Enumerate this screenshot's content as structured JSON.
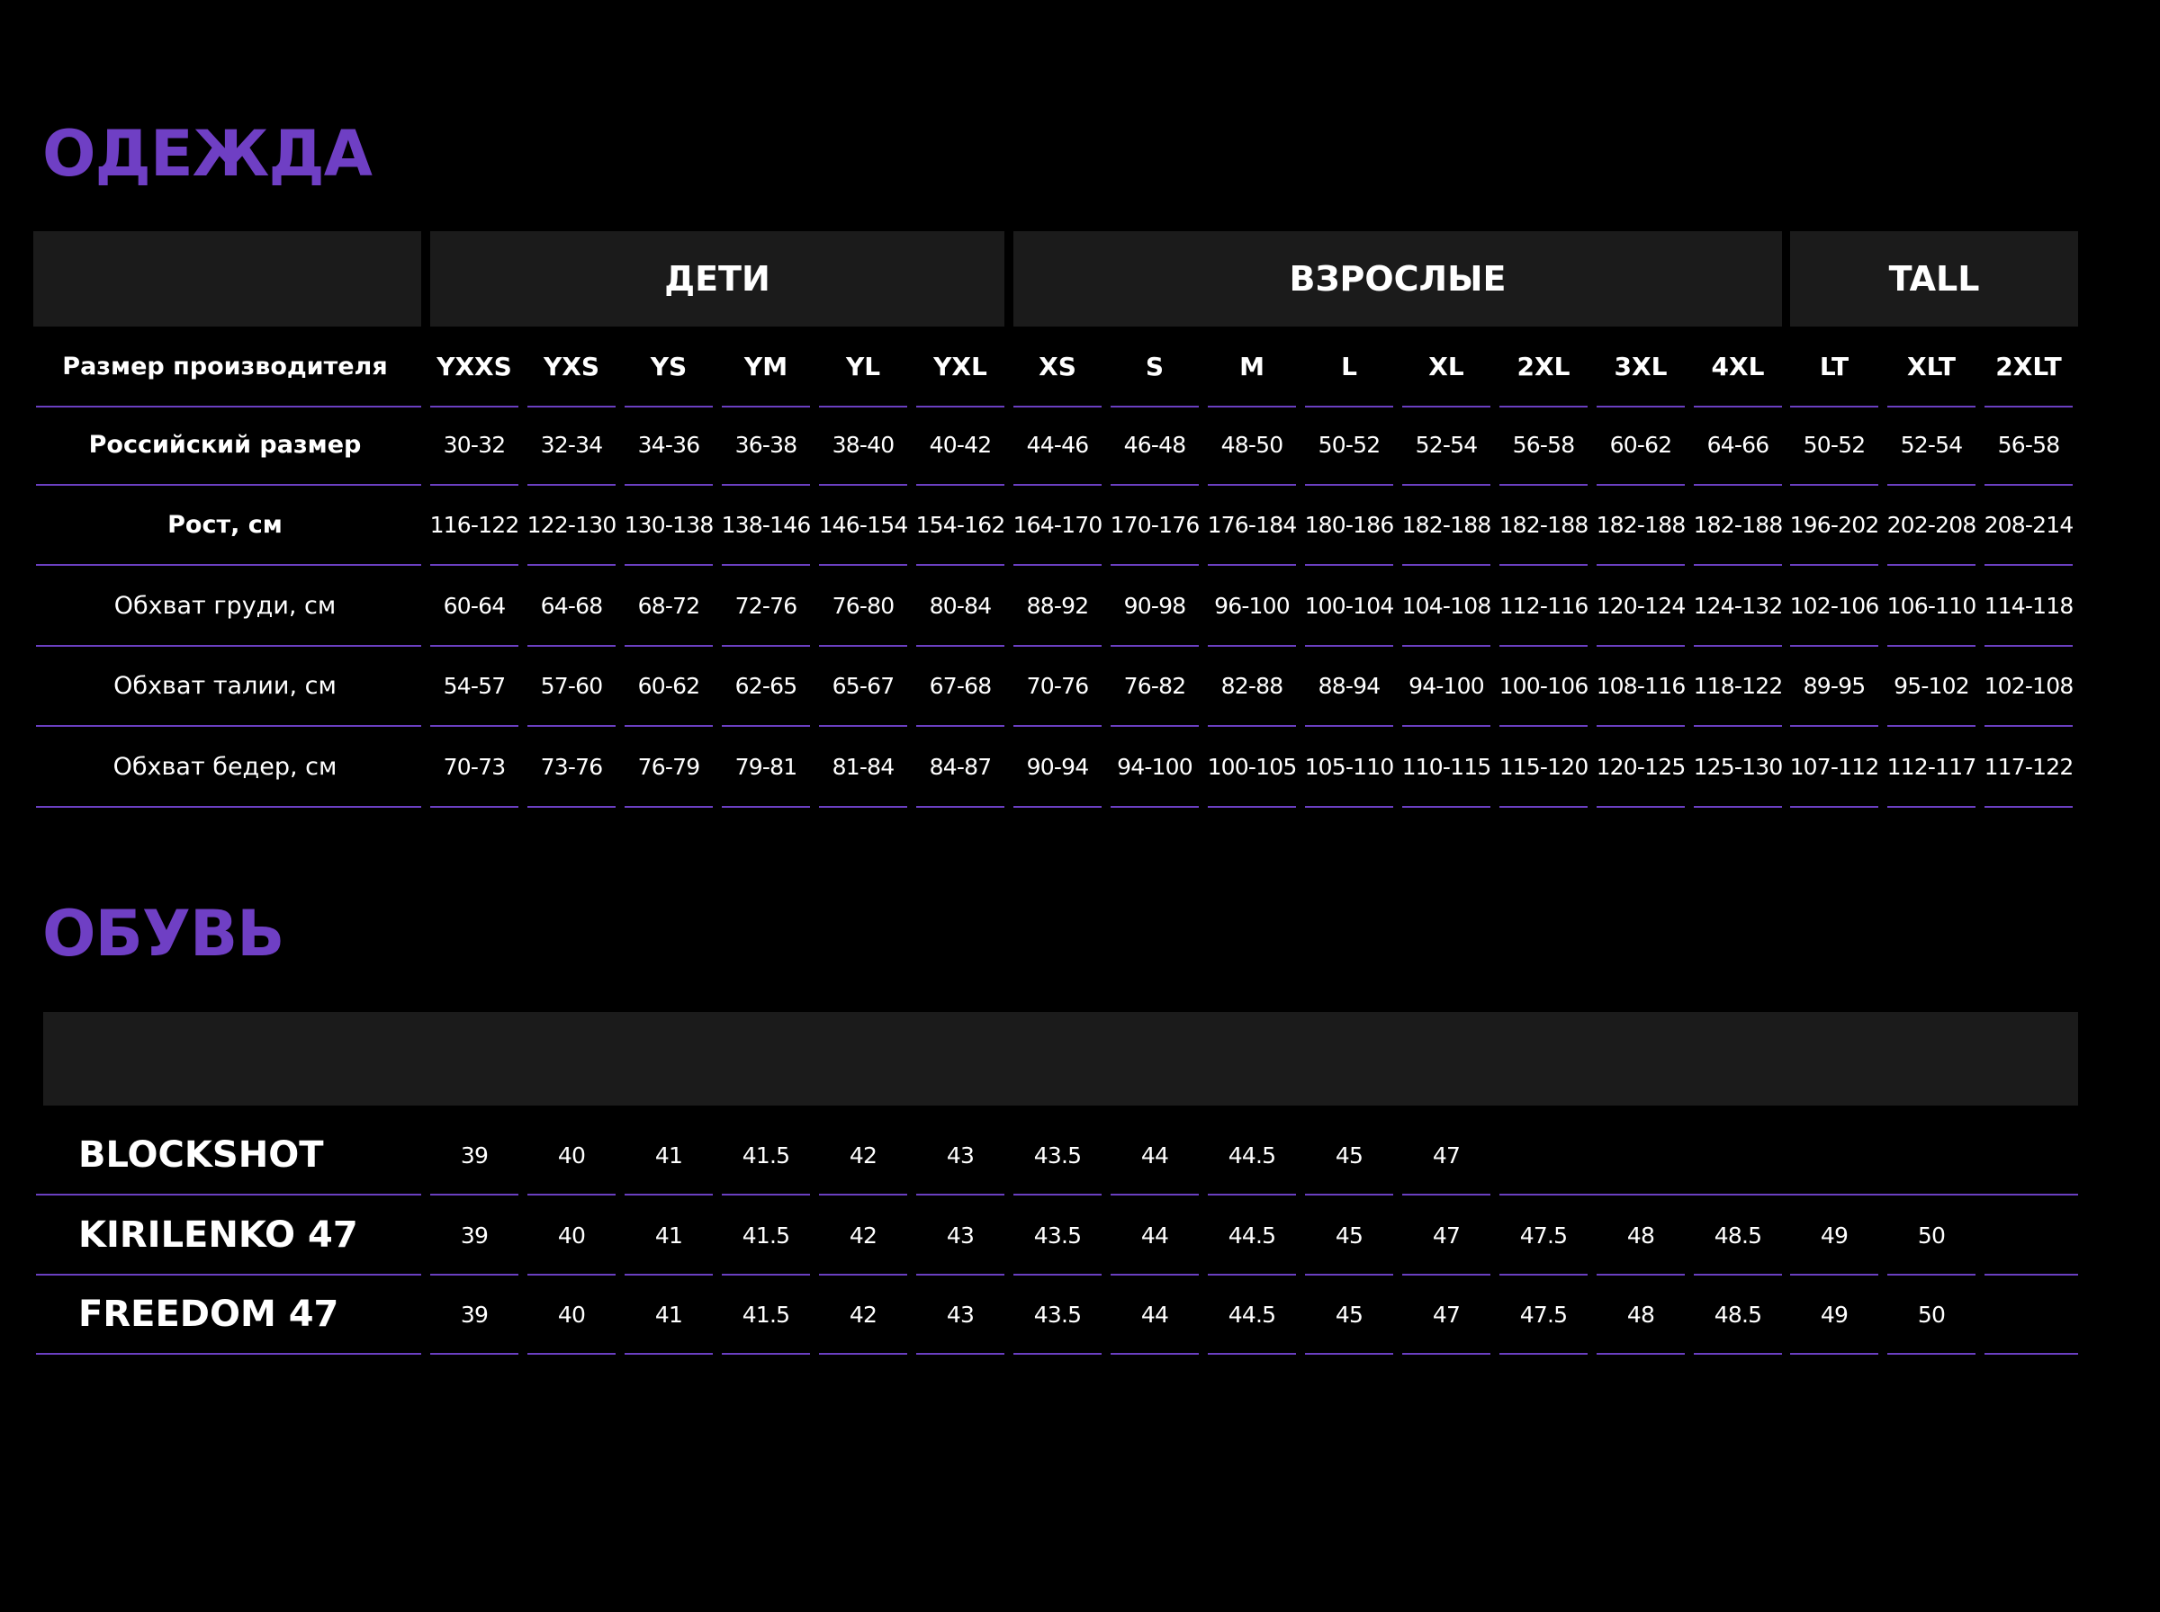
{
  "clothing": {
    "title": "ОДЕЖДА",
    "groups": [
      {
        "label": "ДЕТИ"
      },
      {
        "label": "ВЗРОСЛЫЕ"
      },
      {
        "label": "TALL"
      }
    ],
    "rows": [
      {
        "label": "Размер производителя",
        "bold": true,
        "values": [
          "YXXS",
          "YXS",
          "YS",
          "YM",
          "YL",
          "YXL",
          "XS",
          "S",
          "M",
          "L",
          "XL",
          "2XL",
          "3XL",
          "4XL",
          "LT",
          "XLT",
          "2XLT"
        ]
      },
      {
        "label": "Российский размер",
        "bold": true,
        "values": [
          "30-32",
          "32-34",
          "34-36",
          "36-38",
          "38-40",
          "40-42",
          "44-46",
          "46-48",
          "48-50",
          "50-52",
          "52-54",
          "56-58",
          "60-62",
          "64-66",
          "50-52",
          "52-54",
          "56-58"
        ]
      },
      {
        "label": "Рост, см",
        "bold": true,
        "values": [
          "116-122",
          "122-130",
          "130-138",
          "138-146",
          "146-154",
          "154-162",
          "164-170",
          "170-176",
          "176-184",
          "180-186",
          "182-188",
          "182-188",
          "182-188",
          "182-188",
          "196-202",
          "202-208",
          "208-214"
        ]
      },
      {
        "label": "Обхват груди, см",
        "bold": false,
        "values": [
          "60-64",
          "64-68",
          "68-72",
          "72-76",
          "76-80",
          "80-84",
          "88-92",
          "90-98",
          "96-100",
          "100-104",
          "104-108",
          "112-116",
          "120-124",
          "124-132",
          "102-106",
          "106-110",
          "114-118"
        ]
      },
      {
        "label": "Обхват талии, см",
        "bold": false,
        "values": [
          "54-57",
          "57-60",
          "60-62",
          "62-65",
          "65-67",
          "67-68",
          "70-76",
          "76-82",
          "82-88",
          "88-94",
          "94-100",
          "100-106",
          "108-116",
          "118-122",
          "89-95",
          "95-102",
          "102-108"
        ]
      },
      {
        "label": "Обхват бедер, см",
        "bold": false,
        "values": [
          "70-73",
          "73-76",
          "76-79",
          "79-81",
          "81-84",
          "84-87",
          "90-94",
          "94-100",
          "100-105",
          "105-110",
          "110-115",
          "115-120",
          "120-125",
          "125-130",
          "107-112",
          "112-117",
          "117-122"
        ]
      }
    ]
  },
  "shoes": {
    "title": "ОБУВЬ",
    "rows": [
      {
        "model": "BLOCKSHOT",
        "sizes": [
          "39",
          "40",
          "41",
          "41.5",
          "42",
          "43",
          "43.5",
          "44",
          "44.5",
          "45",
          "47"
        ]
      },
      {
        "model": "KIRILENKO 47",
        "sizes": [
          "39",
          "40",
          "41",
          "41.5",
          "42",
          "43",
          "43.5",
          "44",
          "44.5",
          "45",
          "47",
          "47.5",
          "48",
          "48.5",
          "49",
          "50"
        ]
      },
      {
        "model": "FREEDOM 47",
        "sizes": [
          "39",
          "40",
          "41",
          "41.5",
          "42",
          "43",
          "43.5",
          "44",
          "44.5",
          "45",
          "47",
          "47.5",
          "48",
          "48.5",
          "49",
          "50"
        ]
      }
    ]
  },
  "colors": {
    "accent": "#6f3fc4",
    "line": "#6a3fc0",
    "header_bg": "#1b1b1b",
    "background": "#000000"
  }
}
